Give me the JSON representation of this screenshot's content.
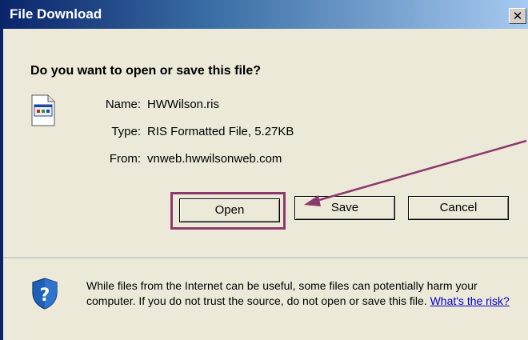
{
  "window": {
    "title": "File Download",
    "close_glyph": "✕"
  },
  "dialog": {
    "question": "Do you want to open or save this file?",
    "file_icon": "ris-file-icon",
    "fields": [
      {
        "label": "Name:",
        "value": "HWWilson.ris"
      },
      {
        "label": "Type:",
        "value": "RIS Formatted File, 5.27KB"
      },
      {
        "label": "From:",
        "value": "vnweb.hwwilsonweb.com"
      }
    ],
    "buttons": {
      "open": "Open",
      "save": "Save",
      "cancel": "Cancel"
    }
  },
  "warning": {
    "icon": "shield-question-icon",
    "text": "While files from the Internet can be useful, some files can potentially harm your computer. If you do not trust the source, do not open or save this file.",
    "link": "What's the risk?"
  },
  "annotation": {
    "color": "#8b3a6b"
  }
}
